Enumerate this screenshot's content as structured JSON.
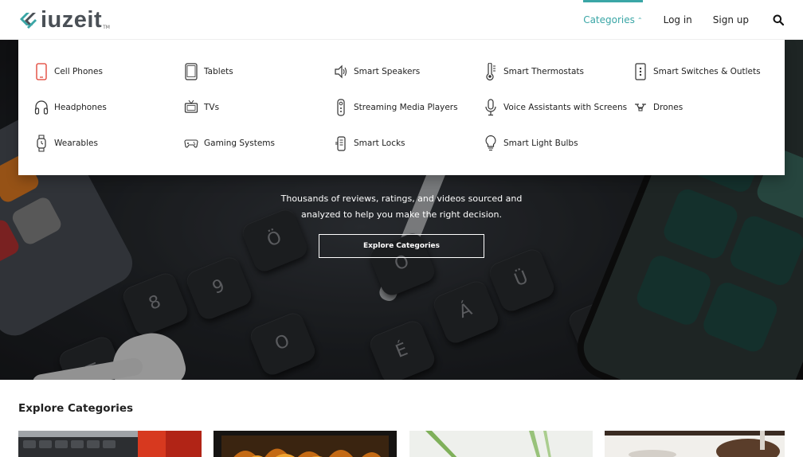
{
  "brand": {
    "name": "iuzeit",
    "tm": "TM",
    "accent": "#3aa6a6"
  },
  "nav": {
    "categories": "Categories",
    "login": "Log in",
    "signup": "Sign up"
  },
  "menu": {
    "items": [
      {
        "label": "Cell Phones",
        "icon": "cell-phone-icon"
      },
      {
        "label": "Tablets",
        "icon": "tablet-icon"
      },
      {
        "label": "Smart Speakers",
        "icon": "speaker-icon"
      },
      {
        "label": "Smart Thermostats",
        "icon": "thermostat-icon"
      },
      {
        "label": "Smart Switches & Outlets",
        "icon": "switch-icon"
      },
      {
        "label": "Headphones",
        "icon": "headphones-icon"
      },
      {
        "label": "TVs",
        "icon": "tv-icon"
      },
      {
        "label": "Streaming Media Players",
        "icon": "remote-icon"
      },
      {
        "label": "Voice Assistants with Screens",
        "icon": "microphone-icon"
      },
      {
        "label": "Drones",
        "icon": "drone-icon"
      },
      {
        "label": "Wearables",
        "icon": "watch-icon"
      },
      {
        "label": "Gaming Systems",
        "icon": "gamepad-icon"
      },
      {
        "label": "Smart Locks",
        "icon": "lock-icon"
      },
      {
        "label": "Smart Light Bulbs",
        "icon": "bulb-icon"
      }
    ]
  },
  "hero": {
    "subtitle_line1": "Thousands of reviews, ratings, and videos sourced and",
    "subtitle_line2": "analyzed to help you make the right decision.",
    "cta": "Explore Categories"
  },
  "explore": {
    "title": "Explore Categories"
  }
}
